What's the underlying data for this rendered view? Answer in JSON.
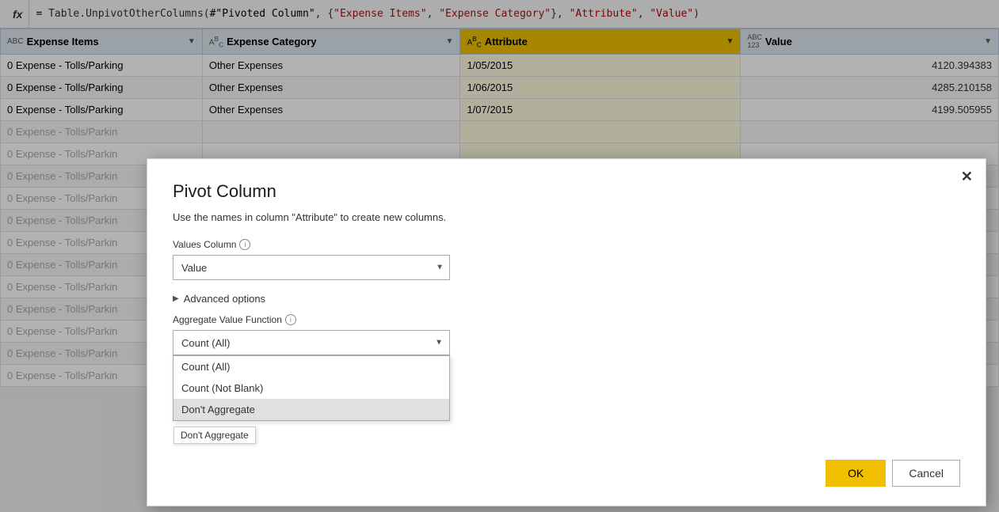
{
  "formulaBar": {
    "fx": "fx",
    "formula": "= Table.UnpivotOtherColumns(#\"Pivoted Column\", {\"Expense Items\", \"Expense Category\"}, \"Attribute\", \"Value\")"
  },
  "table": {
    "columns": [
      {
        "id": "expense-items",
        "type": "ABC",
        "type2": "",
        "label": "Expense Items",
        "highlighted": false
      },
      {
        "id": "expense-category",
        "type": "A",
        "type2": "B\nC",
        "label": "Expense Category",
        "highlighted": false
      },
      {
        "id": "attribute",
        "type": "A",
        "type2": "B\nC",
        "label": "Attribute",
        "highlighted": true
      },
      {
        "id": "value",
        "type": "ABC\n123",
        "type2": "",
        "label": "Value",
        "highlighted": false
      }
    ],
    "rows": [
      {
        "expenseItems": "0 Expense - Tolls/Parking",
        "expenseCategory": "Other Expenses",
        "attribute": "1/05/2015",
        "value": "4120.394383",
        "dimmed": false
      },
      {
        "expenseItems": "0 Expense - Tolls/Parking",
        "expenseCategory": "Other Expenses",
        "attribute": "1/06/2015",
        "value": "4285.210158",
        "dimmed": false
      },
      {
        "expenseItems": "0 Expense - Tolls/Parking",
        "expenseCategory": "Other Expenses",
        "attribute": "1/07/2015",
        "value": "4199.505955",
        "dimmed": false
      },
      {
        "expenseItems": "0 Expense - Tolls/Parkin",
        "expenseCategory": "",
        "attribute": "",
        "value": "",
        "dimmed": true
      },
      {
        "expenseItems": "0 Expense - Tolls/Parkin",
        "expenseCategory": "",
        "attribute": "",
        "value": "",
        "dimmed": true
      },
      {
        "expenseItems": "0 Expense - Tolls/Parkin",
        "expenseCategory": "",
        "attribute": "",
        "value": "",
        "dimmed": true
      },
      {
        "expenseItems": "0 Expense - Tolls/Parkin",
        "expenseCategory": "",
        "attribute": "",
        "value": "",
        "dimmed": true
      },
      {
        "expenseItems": "0 Expense - Tolls/Parkin",
        "expenseCategory": "",
        "attribute": "",
        "value": "",
        "dimmed": true
      },
      {
        "expenseItems": "0 Expense - Tolls/Parkin",
        "expenseCategory": "",
        "attribute": "",
        "value": "",
        "dimmed": true
      },
      {
        "expenseItems": "0 Expense - Tolls/Parkin",
        "expenseCategory": "",
        "attribute": "",
        "value": "",
        "dimmed": true
      },
      {
        "expenseItems": "0 Expense - Tolls/Parkin",
        "expenseCategory": "",
        "attribute": "",
        "value": "",
        "dimmed": true
      },
      {
        "expenseItems": "0 Expense - Tolls/Parkin",
        "expenseCategory": "",
        "attribute": "",
        "value": "",
        "dimmed": true
      },
      {
        "expenseItems": "0 Expense - Tolls/Parkin",
        "expenseCategory": "",
        "attribute": "",
        "value": "",
        "dimmed": true
      },
      {
        "expenseItems": "0 Expense - Tolls/Parkin",
        "expenseCategory": "",
        "attribute": "",
        "value": "",
        "dimmed": true
      },
      {
        "expenseItems": "0 Expense - Tolls/Parkin",
        "expenseCategory": "",
        "attribute": "",
        "value": "",
        "dimmed": true
      }
    ]
  },
  "dialog": {
    "title": "Pivot Column",
    "subtitle": "Use the names in column \"Attribute\" to create new columns.",
    "closeLabel": "✕",
    "valuesColumnLabel": "Values Column",
    "valuesColumnValue": "Value",
    "advancedOptionsLabel": "Advanced options",
    "aggregateFunctionLabel": "Aggregate Value Function",
    "selectedAggregate": "Count (All)",
    "dropdownItems": [
      {
        "label": "Count (All)",
        "selected": false
      },
      {
        "label": "Count (Not Blank)",
        "selected": false
      },
      {
        "label": "Don't Aggregate",
        "selected": false,
        "hovered": true
      }
    ],
    "tooltip": "Don't Aggregate",
    "okLabel": "OK",
    "cancelLabel": "Cancel"
  }
}
